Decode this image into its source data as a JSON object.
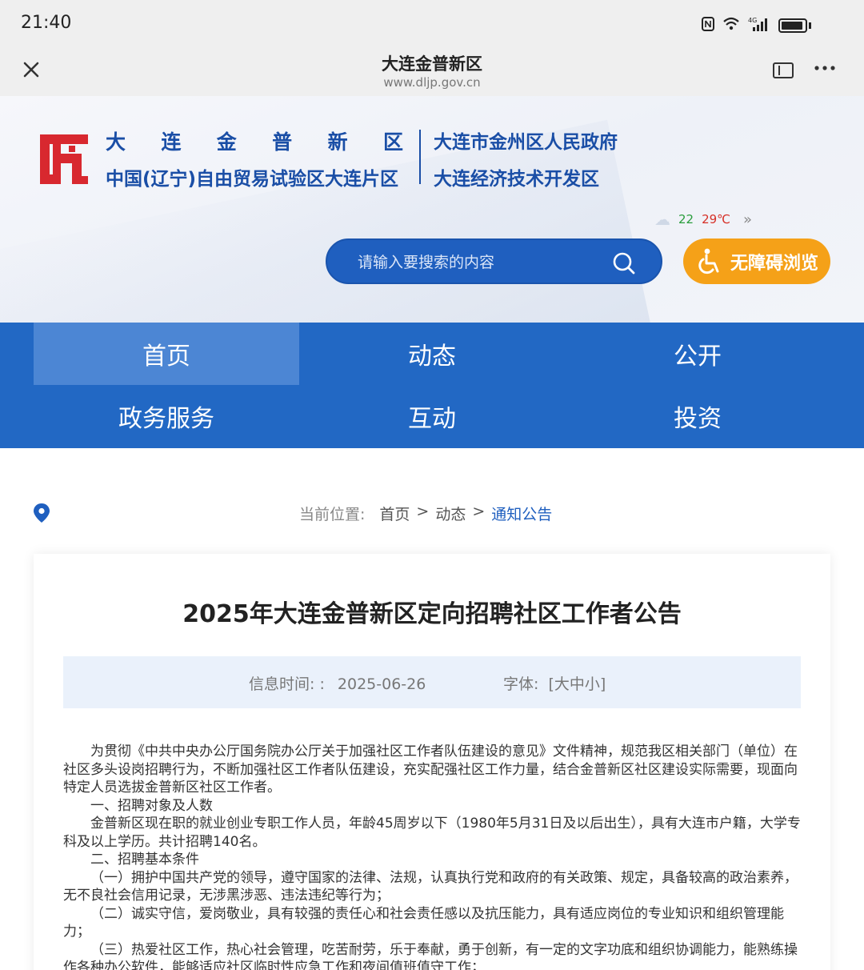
{
  "status": {
    "time": "21:40",
    "network": "4G"
  },
  "browser": {
    "title": "大连金普新区",
    "url": "www.dljp.gov.cn"
  },
  "header": {
    "brand_chars": [
      "大",
      "连",
      "金",
      "普",
      "新",
      "区"
    ],
    "brand_line2": "中国(辽宁)自由贸易试验区大连片区",
    "right_line1": "大连市金州区人民政府",
    "right_line2": "大连经济技术开发区",
    "weather_low": "22",
    "weather_high": "29℃",
    "search_placeholder": "请输入要搜索的内容",
    "accessibility_label": "无障碍浏览",
    "logo_color": "#d8282f",
    "brand_color": "#1a4ea6",
    "accent_orange": "#f5a118"
  },
  "nav": {
    "items": [
      "首页",
      "动态",
      "公开",
      "政务服务",
      "互动",
      "投资"
    ],
    "active": "首页",
    "color": "#2268c4"
  },
  "breadcrumb": {
    "label": "当前位置:",
    "items": [
      "首页",
      "动态"
    ],
    "current": "通知公告",
    "sep": ">"
  },
  "article": {
    "title": "2025年大连金普新区定向招聘社区工作者公告",
    "time_label": "信息时间: :",
    "date": "2025-06-26",
    "font_label": "字体:",
    "font_open": "[",
    "font_sizes": [
      "大",
      "中",
      "小"
    ],
    "font_close": "]",
    "paragraphs": [
      {
        "text": "为贯彻《中共中央办公厅国务院办公厅关于加强社区工作者队伍建设的意见》文件精神，规范我区相关部门（单位）在社区多头设岗招聘行为，不断加强社区工作者队伍建设，充实配强社区工作力量，结合金普新区社区建设实际需要，现面向特定人员选拔金普新区社区工作者。",
        "indent": true
      },
      {
        "text": "一、招聘对象及人数",
        "indent": true
      },
      {
        "text": "金普新区现在职的就业创业专职工作人员，年龄45周岁以下（1980年5月31日及以后出生），具有大连市户籍，大学专科及以上学历。共计招聘140名。",
        "indent": true
      },
      {
        "text": "二、招聘基本条件",
        "indent": true
      },
      {
        "text": "（一）拥护中国共产党的领导，遵守国家的法律、法规，认真执行党和政府的有关政策、规定，具备较高的政治素养，无不良社会信用记录，无涉黑涉恶、违法违纪等行为；",
        "indent": true
      },
      {
        "text": "（二）诚实守信，爱岗敬业，具有较强的责任心和社会责任感以及抗压能力，具有适应岗位的专业知识和组织管理能力；",
        "indent": true
      },
      {
        "text": "（三）热爱社区工作，热心社会管理，吃苦耐劳，乐于奉献，勇于创新，有一定的文字功底和组织协调能力，能熟练操作各种办公软件，能够适应社区临时性应急工作和夜间值班值守工作；",
        "indent": true
      }
    ]
  }
}
